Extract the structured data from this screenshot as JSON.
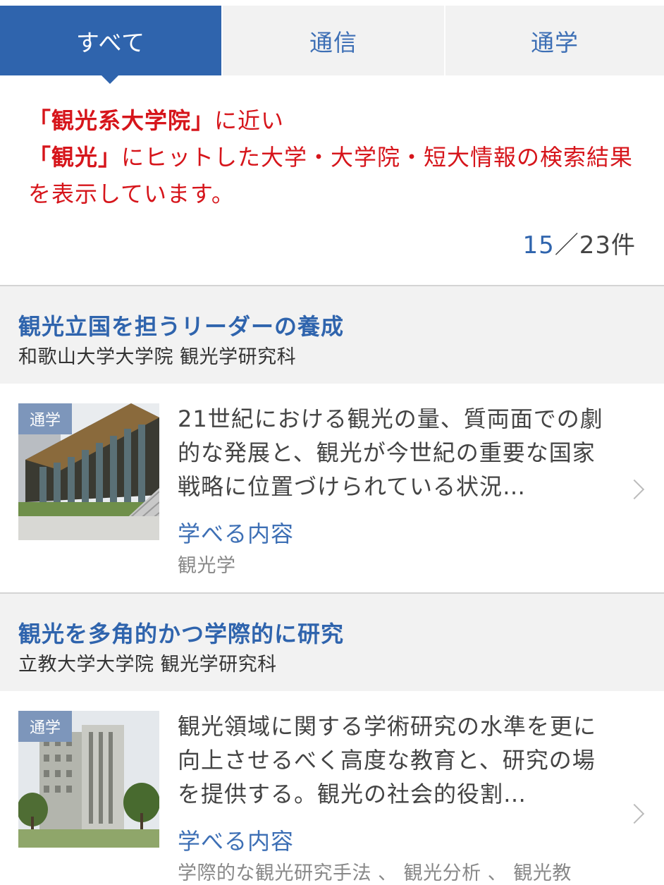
{
  "tabs": [
    {
      "label": "すべて"
    },
    {
      "label": "通信"
    },
    {
      "label": "通学"
    }
  ],
  "notice": {
    "q1": "「観光系大学院」",
    "t1": "に近い",
    "q2": "「観光」",
    "t2": "にヒットした大学・大学院・短大情報の検索結果を表示しています。"
  },
  "count": {
    "current": "15",
    "total": "／23件"
  },
  "cards": [
    {
      "title": "観光立国を担うリーダーの養成",
      "subtitle": "和歌山大学大学院 観光学研究科",
      "badge": "通学",
      "description": "21世紀における観光の量、質両面での劇的な発展と、観光が今世紀の重要な国家戦略に位置づけられている状況…",
      "learn_label": "学べる内容",
      "learn_value": "観光学"
    },
    {
      "title": "観光を多角的かつ学際的に研究",
      "subtitle": "立教大学大学院 観光学研究科",
      "badge": "通学",
      "description": "観光領域に関する学術研究の水準を更に向上させるべく高度な教育と、研究の場を提供する。観光の社会的役割…",
      "learn_label": "学べる内容",
      "learn_value": "学際的な観光研究手法 、 観光分析 、 観光教"
    }
  ]
}
